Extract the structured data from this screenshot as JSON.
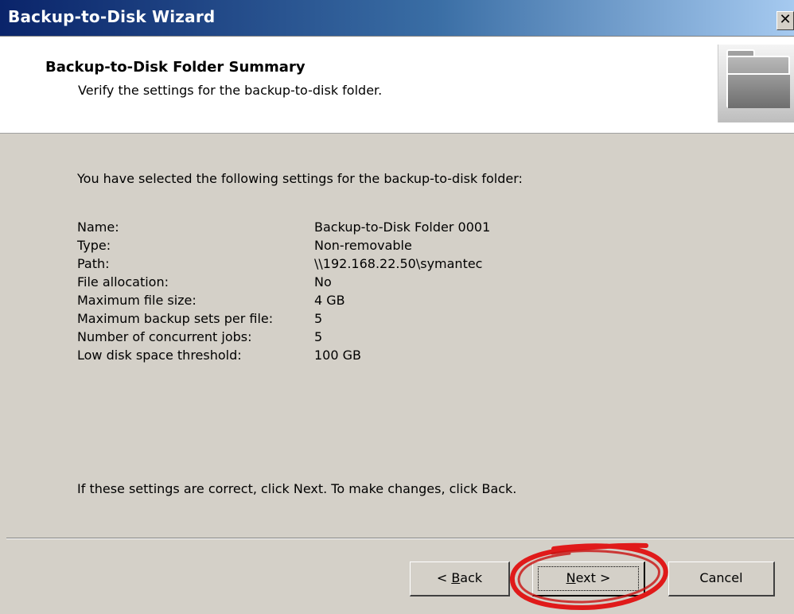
{
  "window": {
    "title": "Backup-to-Disk Wizard",
    "close_glyph": "✕"
  },
  "header": {
    "title": "Backup-to-Disk Folder Summary",
    "subtitle": "Verify the settings for the backup-to-disk folder.",
    "icon": "folder-icon"
  },
  "body": {
    "intro": "You have selected the following settings for the backup-to-disk folder:",
    "settings": [
      {
        "label": "Name:",
        "value": "Backup-to-Disk Folder 0001"
      },
      {
        "label": "Type:",
        "value": "Non-removable"
      },
      {
        "label": "Path:",
        "value": "\\\\192.168.22.50\\symantec"
      },
      {
        "label": "File allocation:",
        "value": "No"
      },
      {
        "label": "Maximum file size:",
        "value": "4 GB"
      },
      {
        "label": "Maximum backup sets per file:",
        "value": "5"
      },
      {
        "label": "Number of concurrent jobs:",
        "value": "5"
      },
      {
        "label": "Low disk space threshold:",
        "value": "100 GB"
      }
    ],
    "footer_note": "If these settings are correct, click Next.  To make changes, click Back."
  },
  "buttons": {
    "back": {
      "prefix": "< ",
      "mnemonic": "B",
      "rest": "ack"
    },
    "next": {
      "mnemonic": "N",
      "rest": "ext >"
    },
    "cancel": "Cancel"
  },
  "colors": {
    "dialog_bg": "#d4d0c8",
    "highlight": "#e01a1a"
  }
}
